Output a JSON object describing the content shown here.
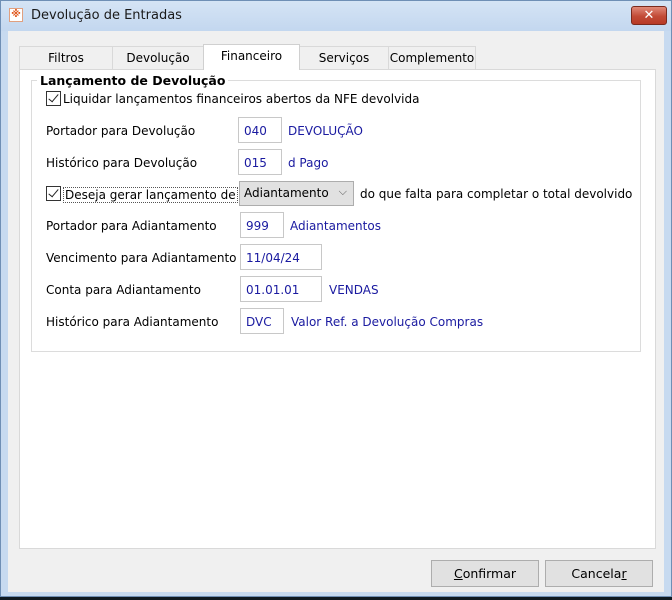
{
  "window": {
    "title": "Devolução de Entradas",
    "app_icon": "app-logo-icon",
    "close_icon": "close-icon"
  },
  "tabs": [
    {
      "label": "Filtros"
    },
    {
      "label": "Devolução"
    },
    {
      "label": "Financeiro",
      "active": true
    },
    {
      "label": "Serviços"
    },
    {
      "label": "Complemento"
    }
  ],
  "group": {
    "title": "Lançamento de Devolução",
    "liquidar": {
      "label": "Liquidar lançamentos financeiros abertos da NFE devolvida",
      "checked": true
    },
    "portador_dev": {
      "label": "Portador para Devolução",
      "value": "040",
      "desc": "DEVOLUÇÃO"
    },
    "historico_dev": {
      "label": "Histórico para Devolução",
      "value": "015",
      "desc": "d Pago"
    },
    "gerar": {
      "label": "Deseja gerar lançamento de",
      "checked": true,
      "selected": "Adiantamento",
      "suffix": "do que falta para completar o total devolvido"
    },
    "portador_adi": {
      "label": "Portador para Adiantamento",
      "value": "999",
      "desc": "Adiantamentos"
    },
    "vencimento_adi": {
      "label": "Vencimento para Adiantamento",
      "value": "11/04/24"
    },
    "conta_adi": {
      "label": "Conta para Adiantamento",
      "value": "01.01.01",
      "desc": "VENDAS"
    },
    "historico_adi": {
      "label": "Histórico para Adiantamento",
      "value": "DVC",
      "desc": "Valor Ref. a Devolução Compras"
    }
  },
  "buttons": {
    "confirm_first": "C",
    "confirm_rest": "onfirmar",
    "cancel_main": "Cancela",
    "cancel_last": "r"
  }
}
